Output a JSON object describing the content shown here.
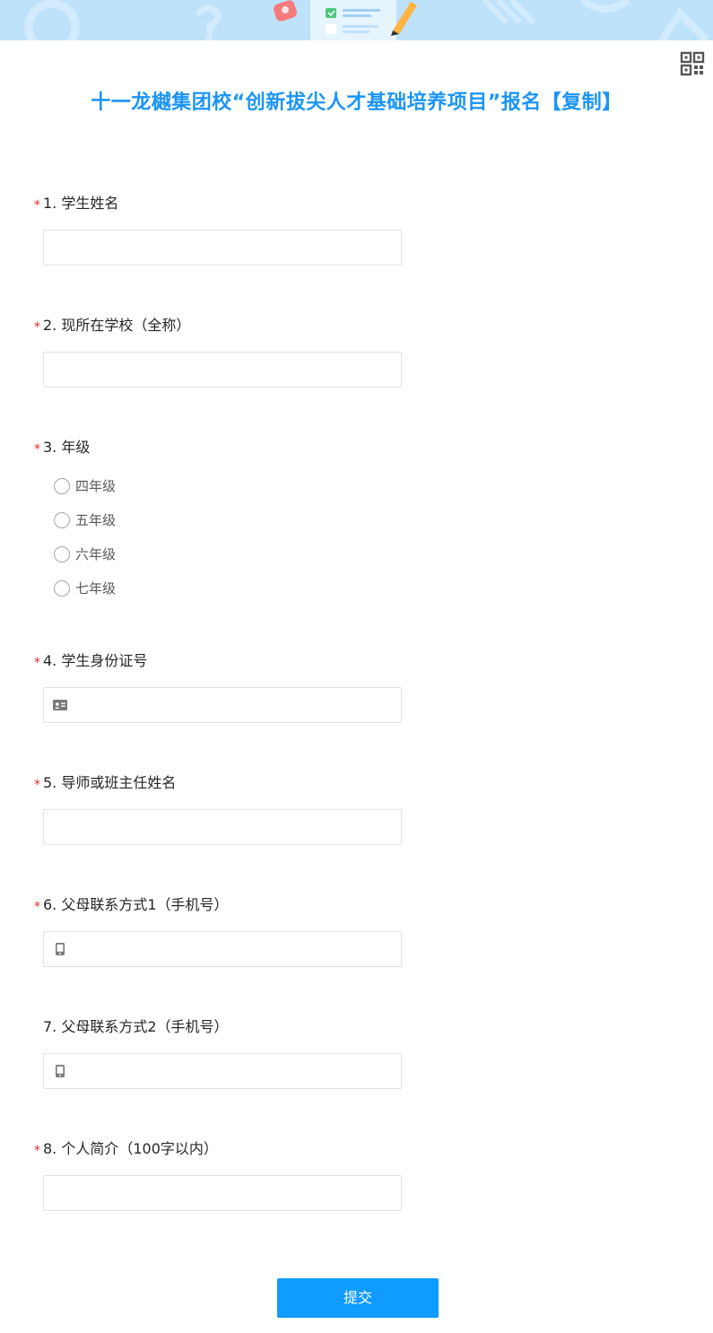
{
  "form": {
    "title": "十一龙樾集团校“创新拔尖人才基础培养项目”报名【复制】",
    "required_mark": "*",
    "submit_label": "提交"
  },
  "icons": {
    "qr_code": "qr-code-icon",
    "id_card": "id-card-icon",
    "mobile_phone": "mobile-phone-icon"
  },
  "colors": {
    "title": "#1b95f5",
    "banner": "#bfe2fb",
    "required": "#f5222d",
    "submit": "#0f9bff"
  },
  "questions": [
    {
      "label": "1. 学生姓名",
      "required": true,
      "type": "text",
      "value": ""
    },
    {
      "label": "2. 现所在学校（全称）",
      "required": true,
      "type": "text",
      "value": ""
    },
    {
      "label": "3. 年级",
      "required": true,
      "type": "radio",
      "options": [
        "四年级",
        "五年级",
        "六年级",
        "七年级"
      ],
      "selected": null
    },
    {
      "label": "4. 学生身份证号",
      "required": true,
      "type": "id_card",
      "value": ""
    },
    {
      "label": "5. 导师或班主任姓名",
      "required": true,
      "type": "text",
      "value": ""
    },
    {
      "label": "6. 父母联系方式1（手机号）",
      "required": true,
      "type": "phone",
      "value": ""
    },
    {
      "label": "7. 父母联系方式2（手机号）",
      "required": false,
      "type": "phone",
      "value": ""
    },
    {
      "label": "8. 个人简介（100字以内）",
      "required": true,
      "type": "text",
      "value": ""
    }
  ]
}
